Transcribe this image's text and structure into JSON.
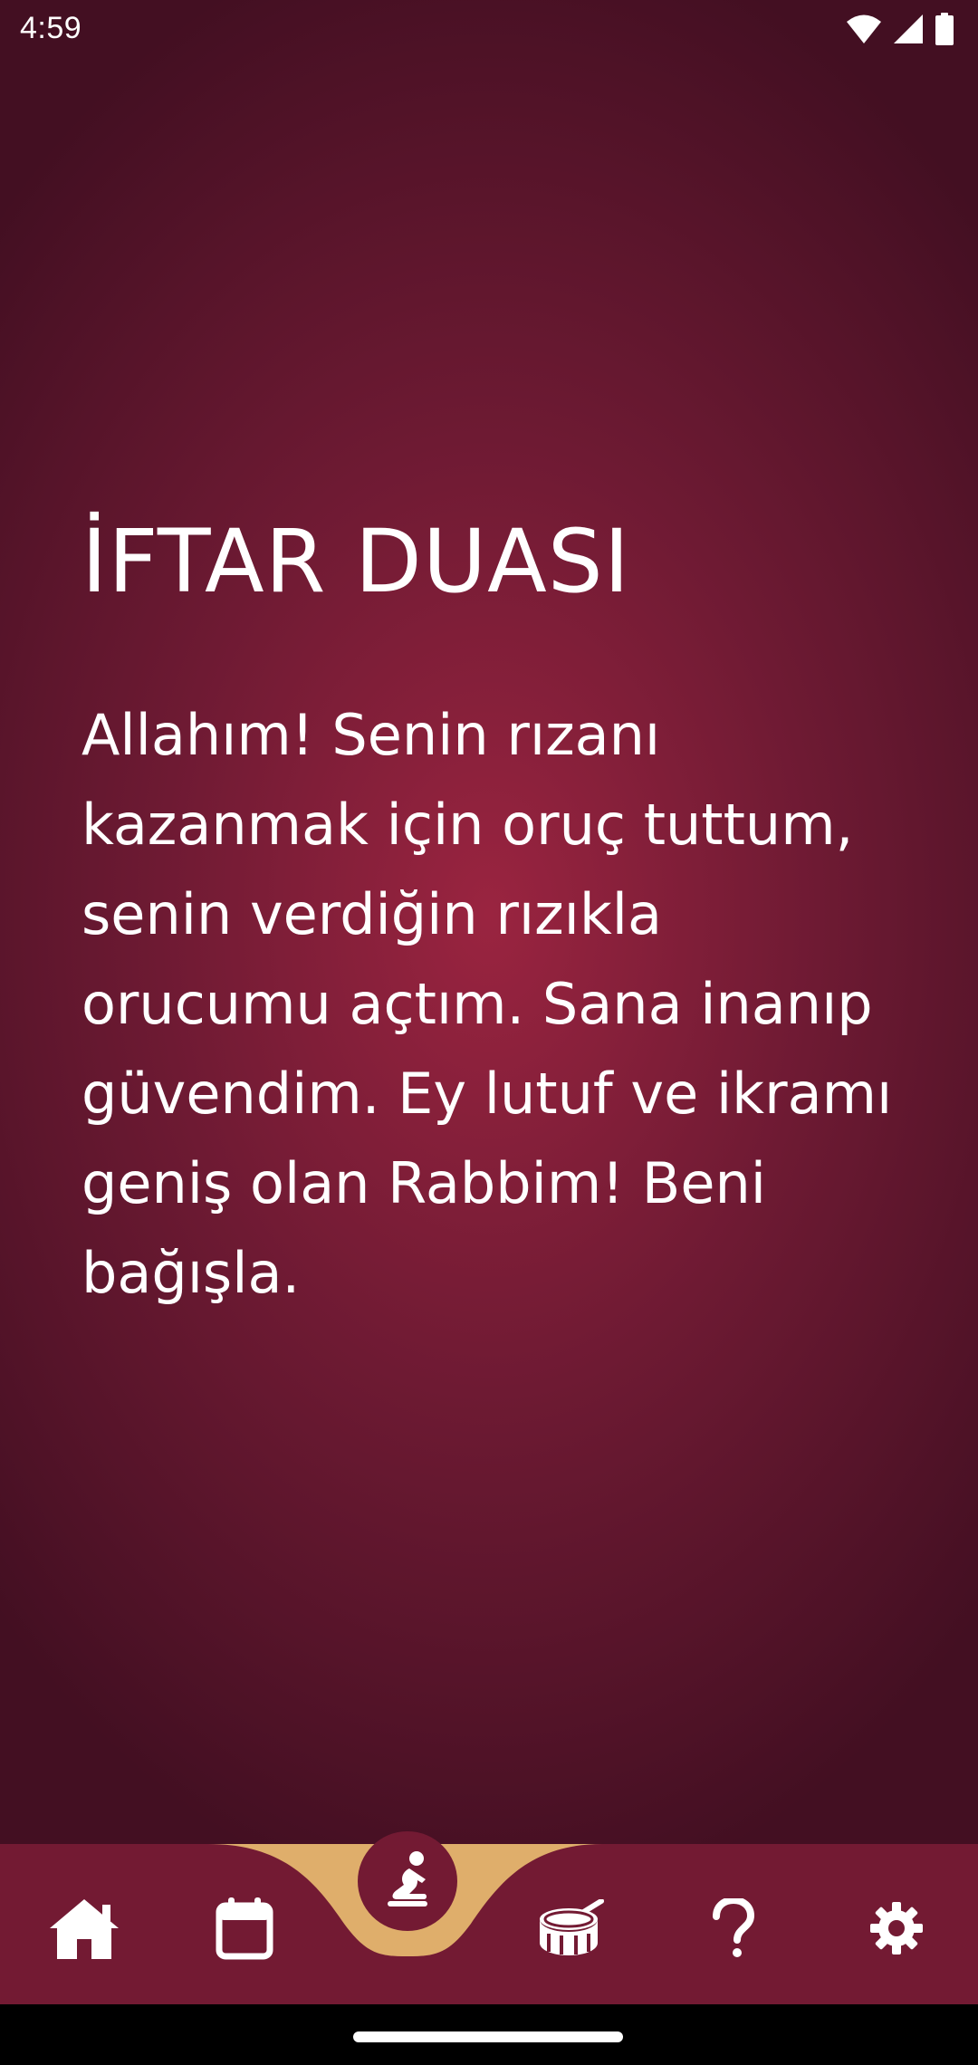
{
  "status_bar": {
    "time": "4:59",
    "icons": [
      "wifi-icon",
      "signal-icon",
      "battery-icon"
    ]
  },
  "page": {
    "title": "İFTAR DUASI",
    "prayer_text": "Allahım! Senin rızanı kazanmak için oruç tuttum, senin verdiğin rızıkla orucumu açtım. Sana inanıp güvendim. Ey lutuf ve ikramı geniş olan Rabbim! Beni bağışla."
  },
  "bottom_nav": {
    "items": [
      {
        "id": "home",
        "icon": "home-icon"
      },
      {
        "id": "calendar",
        "icon": "calendar-icon"
      },
      {
        "id": "prayer",
        "icon": "praying-person-icon",
        "active": true
      },
      {
        "id": "drum",
        "icon": "drum-icon"
      },
      {
        "id": "help",
        "icon": "question-mark-icon"
      },
      {
        "id": "settings",
        "icon": "gear-icon"
      }
    ]
  },
  "colors": {
    "background_center": "#9a2440",
    "background_edge": "#430f22",
    "nav_background": "#731a33",
    "nav_accent": "#dfae6b",
    "text": "#ffffff"
  }
}
